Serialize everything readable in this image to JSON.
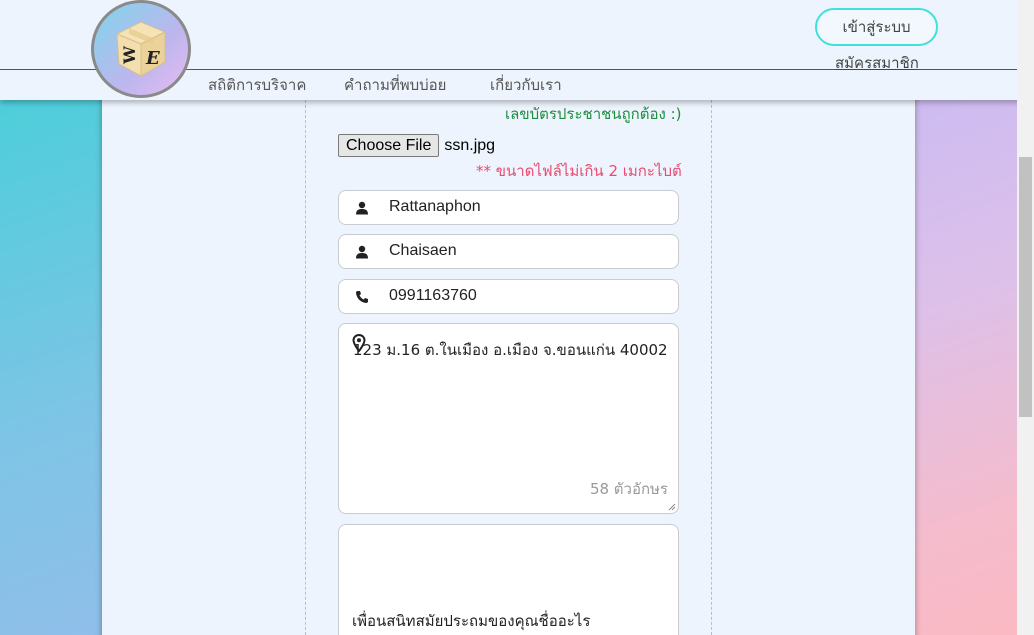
{
  "header": {
    "logo_letters": [
      "W",
      "E"
    ],
    "nav": [
      {
        "label": "สถิติการบริจาค"
      },
      {
        "label": "คำถามที่พบบ่อย"
      },
      {
        "label": "เกี่ยวกับเรา"
      }
    ],
    "login_label": "เข้าสู่ระบบ",
    "register_label": "สมัครสมาชิก"
  },
  "form": {
    "ssn_valid_message": "เลขบัตรประชาชนถูกต้อง :)",
    "file_button_label": "Choose File",
    "file_name": "ssn.jpg",
    "file_note": "** ขนาดไฟล์ไม่เกิน 2 เมกะไบต์",
    "first_name": "Rattanaphon",
    "last_name": "Chaisaen",
    "phone": "0991163760",
    "address": "123 ม.16 ต.ในเมือง อ.เมือง จ.ขอนแก่น 40002",
    "address_count": "58 ตัวอักษร",
    "security_question": "เพื่อนสนิทสมัยประถมของคุณชื่ออะไร"
  },
  "colors": {
    "accent_turquoise": "#40e0dc",
    "success_green": "#1e8e3e",
    "warning_pink": "#ea4b6e",
    "panel_bg": "#edf4fd"
  }
}
